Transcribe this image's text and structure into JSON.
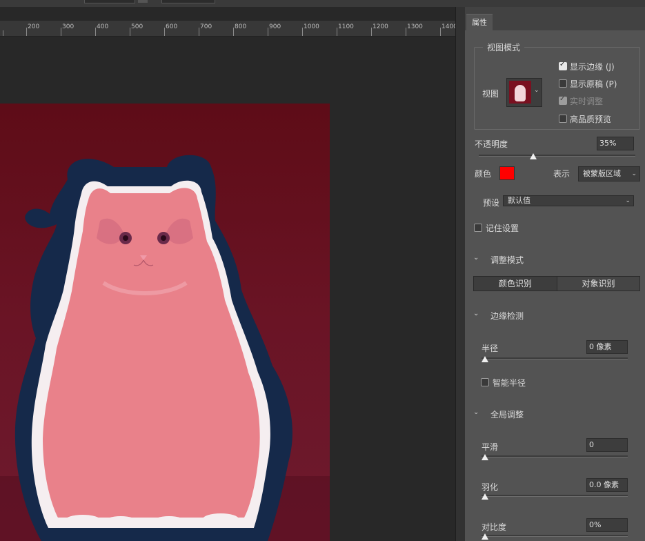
{
  "ruler": {
    "ticks": [
      "200",
      "300",
      "400",
      "500",
      "600",
      "700",
      "800",
      "900",
      "1000",
      "1100",
      "1200",
      "1300",
      "1400"
    ]
  },
  "panel": {
    "tab_label": "属性",
    "view_mode": {
      "legend": "视图模式",
      "view_label": "视图",
      "options": [
        {
          "label": "显示边缘 (J)",
          "checked": true
        },
        {
          "label": "显示原稿 (P)",
          "checked": false
        },
        {
          "label": "实时调整",
          "checked": true,
          "disabled": true
        },
        {
          "label": "高品质预览",
          "checked": false
        }
      ]
    },
    "opacity": {
      "label": "不透明度",
      "value": "35%",
      "level": 0.35
    },
    "color": {
      "label": "颜色",
      "swatch": "#ff0000"
    },
    "indicates": {
      "label": "表示",
      "value": "被蒙版区域"
    },
    "preset": {
      "label": "预设",
      "value": "默认值"
    },
    "remember": {
      "label": "记住设置",
      "checked": false
    },
    "adjust_mode": {
      "title": "调整模式",
      "buttons": [
        "颜色识别",
        "对象识别"
      ],
      "active_index": 1
    },
    "edge_detection": {
      "title": "边缘检测",
      "radius": {
        "label": "半径",
        "value": "0 像素",
        "level": 0
      },
      "smart_radius": {
        "label": "智能半径",
        "checked": false
      }
    },
    "global_refine": {
      "title": "全局调整",
      "smooth": {
        "label": "平滑",
        "value": "0",
        "level": 0
      },
      "feather": {
        "label": "羽化",
        "value": "0.0 像素",
        "level": 0
      },
      "contrast": {
        "label": "对比度",
        "value": "0%",
        "level": 0
      }
    }
  },
  "colors": {
    "annotation_arrow": "#e02020",
    "background_red": "#5e0c17",
    "overlay_pink": "#e9818a",
    "edge_navy": "#152a4a"
  }
}
